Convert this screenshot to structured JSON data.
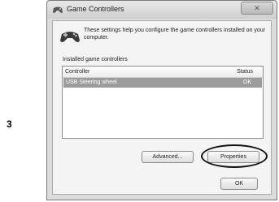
{
  "step_number": "3",
  "window": {
    "title": "Game Controllers",
    "close_label": "✕"
  },
  "intro_text": "These settings help you configure the game controllers installed on your computer.",
  "installed_group_label": "Installed game controllers",
  "list": {
    "columns": [
      "Controller",
      "Status"
    ],
    "rows": [
      {
        "controller": "USB Steering wheel",
        "status": "OK",
        "selected": true
      }
    ]
  },
  "buttons": {
    "advanced": "Advanced...",
    "properties": "Properties",
    "ok": "OK"
  },
  "icons": {
    "title_icon": "gamepad-icon",
    "header_icon": "gamepad-icon"
  },
  "colors": {
    "selected_row": "#9c9c9c",
    "highlight_ellipse": "#111111"
  }
}
